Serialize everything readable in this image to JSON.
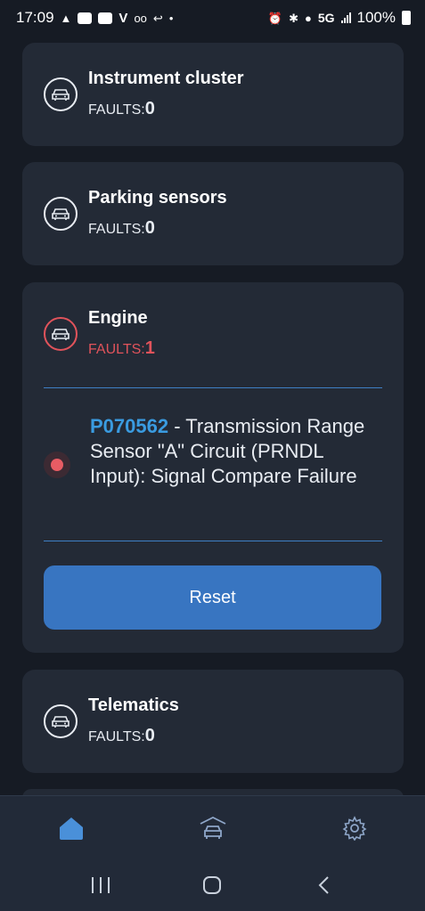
{
  "status_bar": {
    "time": "17:09",
    "network": "5G",
    "battery": "100%"
  },
  "systems": [
    {
      "title": "Instrument cluster",
      "faults_label": "FAULTS:",
      "faults_count": "0",
      "icon": "car-icon"
    },
    {
      "title": "Parking sensors",
      "faults_label": "FAULTS:",
      "faults_count": "0",
      "icon": "car-icon"
    },
    {
      "title": "Engine",
      "faults_label": "FAULTS:",
      "faults_count": "1",
      "icon": "car-icon",
      "dtc": {
        "code": "P070562",
        "description": " - Transmission Range Sensor \"A\" Circuit (PRNDL Input): Signal Compare Failure"
      },
      "reset_label": "Reset"
    },
    {
      "title": "Telematics",
      "faults_label": "FAULTS:",
      "faults_count": "0",
      "icon": "car-icon"
    }
  ],
  "colors": {
    "accent": "#3875c1",
    "code": "#3a9be0",
    "fault": "#e0535b",
    "card": "#232a36",
    "background": "#161b24"
  },
  "bottom_nav": [
    {
      "icon": "home-icon",
      "active": true
    },
    {
      "icon": "garage-icon",
      "active": false
    },
    {
      "icon": "gear-icon",
      "active": false
    }
  ]
}
